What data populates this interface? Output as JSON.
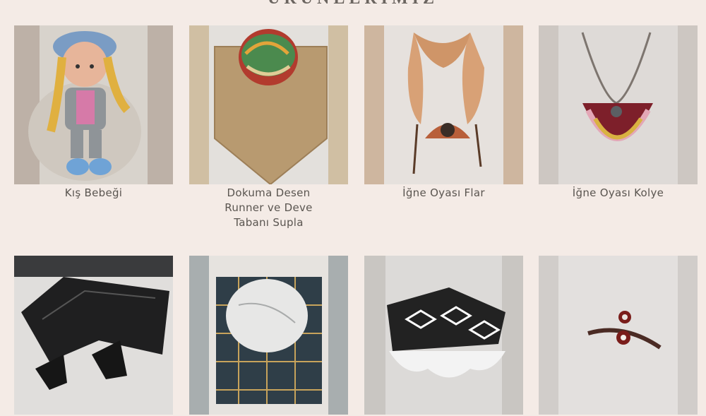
{
  "section": {
    "title": "ÜRÜNLERİMİZ"
  },
  "products": [
    {
      "name": "Kış Bebeği"
    },
    {
      "name": "Dokuma Desen Runner ve Deve Tabanı Supla"
    },
    {
      "name": "İğne Oyası Flar"
    },
    {
      "name": "İğne Oyası Kolye"
    },
    {
      "name": ""
    },
    {
      "name": ""
    },
    {
      "name": ""
    },
    {
      "name": ""
    }
  ]
}
